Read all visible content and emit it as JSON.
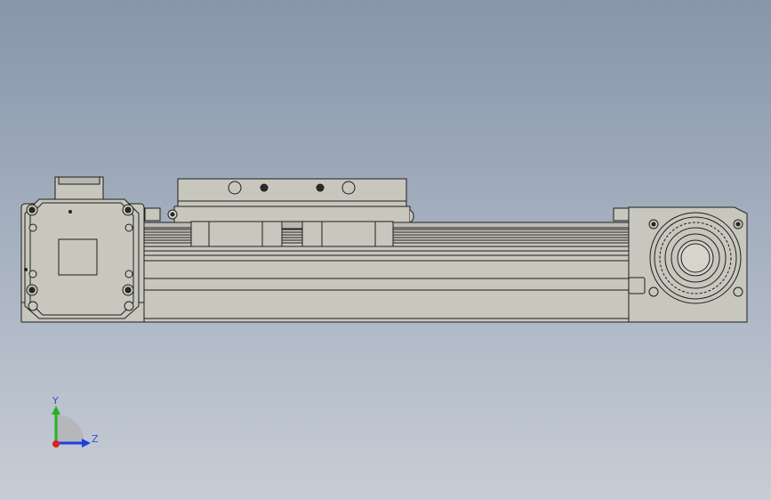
{
  "viewport": {
    "background_top": "#8796AB",
    "background_bottom": "#C7CDD6"
  },
  "model": {
    "body_fill": "#C8C7BD",
    "body_fill_light": "#D2D1C8",
    "body_fill_dark": "#A9A89F",
    "edge_color": "#1E1E1E"
  },
  "triad": {
    "y_label": "Y",
    "z_label": "Z",
    "y_color": "#22B422",
    "z_color": "#1F3FE0",
    "x_color": "#E01F1F",
    "label_color": "#3553C8"
  }
}
